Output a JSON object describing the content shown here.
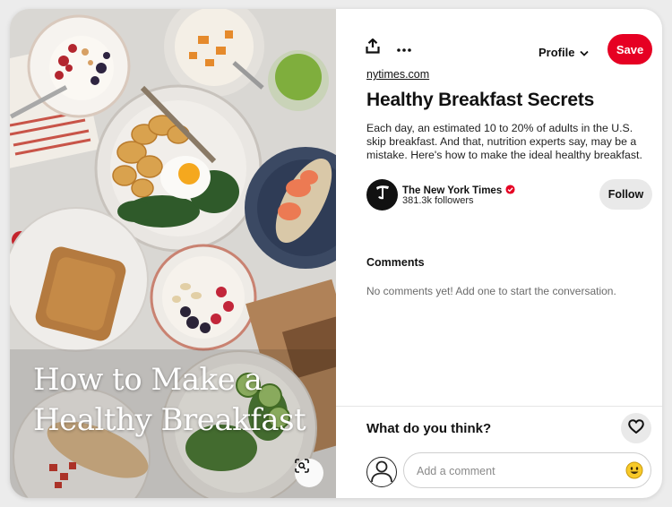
{
  "image": {
    "overlay_title_line1": "How to Make a",
    "overlay_title_line2": "Healthy Breakfast",
    "visual_search_icon": "lens-icon"
  },
  "header": {
    "share_icon": "share-icon",
    "more_icon": "more-icon",
    "profile_label": "Profile",
    "save_label": "Save"
  },
  "pin": {
    "source": "nytimes.com",
    "title": "Healthy Breakfast Secrets",
    "description": "Each day, an estimated 10 to 20% of adults in the U.S. skip breakfast. And that, nutrition experts say, may be a mistake. Here's how to make the ideal healthy breakfast."
  },
  "creator": {
    "name": "The New York Times",
    "followers": "381.3k followers",
    "follow_label": "Follow",
    "verified_icon": "verified-badge-icon"
  },
  "comments": {
    "heading": "Comments",
    "empty_text": "No comments yet! Add one to start the conversation."
  },
  "composer": {
    "prompt": "What do you think?",
    "placeholder": "Add a comment",
    "heart_icon": "heart-icon",
    "emoji_icon": "emoji-icon"
  },
  "colors": {
    "brand_red": "#e60023",
    "button_gray": "#e9e9e9"
  }
}
